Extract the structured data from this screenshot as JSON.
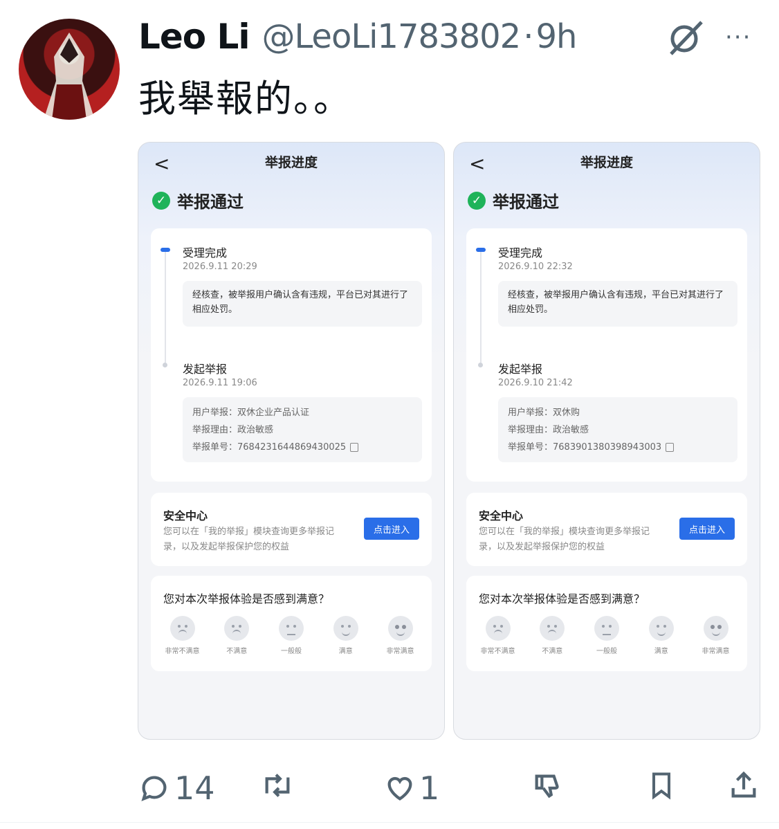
{
  "tweet": {
    "display_name": "Leo Li",
    "handle": "@LeoLi1783802",
    "separator": "·",
    "time": "9h",
    "more_label": "···",
    "text": "我舉報的。。"
  },
  "screenshots": [
    {
      "back": "<",
      "title": "举报进度",
      "status": "举报通过",
      "step1": {
        "title": "受理完成",
        "time": "2026.9.11 20:29",
        "detail": "经核查，被举报用户确认含有违规，平台已对其进行了相应处罚。"
      },
      "step2": {
        "title": "发起举报",
        "time": "2026.9.11 19:06",
        "user_label": "用户举报：",
        "user_value": "双休企业产品认证",
        "reason_label": "举报理由：",
        "reason_value": "政治敏感",
        "id_label": "举报单号：",
        "id_value": "7684231644869430025"
      },
      "security": {
        "title": "安全中心",
        "desc": "您可以在「我的举报」模块查询更多举报记录，以及发起举报保护您的权益",
        "button": "点击进入"
      },
      "rating": {
        "question": "您对本次举报体验是否感到满意？",
        "options": [
          "非常不满意",
          "不满意",
          "一般般",
          "满意",
          "非常满意"
        ]
      }
    },
    {
      "back": "<",
      "title": "举报进度",
      "status": "举报通过",
      "step1": {
        "title": "受理完成",
        "time": "2026.9.10 22:32",
        "detail": "经核查，被举报用户确认含有违规，平台已对其进行了相应处罚。"
      },
      "step2": {
        "title": "发起举报",
        "time": "2026.9.10 21:42",
        "user_label": "用户举报：",
        "user_value": "双休购",
        "reason_label": "举报理由：",
        "reason_value": "政治敏感",
        "id_label": "举报单号：",
        "id_value": "7683901380398943003"
      },
      "security": {
        "title": "安全中心",
        "desc": "您可以在「我的举报」模块查询更多举报记录，以及发起举报保护您的权益",
        "button": "点击进入"
      },
      "rating": {
        "question": "您对本次举报体验是否感到满意？",
        "options": [
          "非常不满意",
          "不满意",
          "一般般",
          "满意",
          "非常满意"
        ]
      }
    }
  ],
  "actions": {
    "replies": "14",
    "retweets": "",
    "likes": "1",
    "reply_icon": "reply-icon",
    "retweet_icon": "retweet-icon",
    "like_icon": "heart-icon",
    "dislike_icon": "dislike-icon",
    "bookmark_icon": "bookmark-icon",
    "share_icon": "share-icon"
  },
  "colors": {
    "text_primary": "#0f1419",
    "text_secondary": "#536471",
    "accent_blue": "#2a6ee8",
    "success_green": "#1fb35a"
  }
}
